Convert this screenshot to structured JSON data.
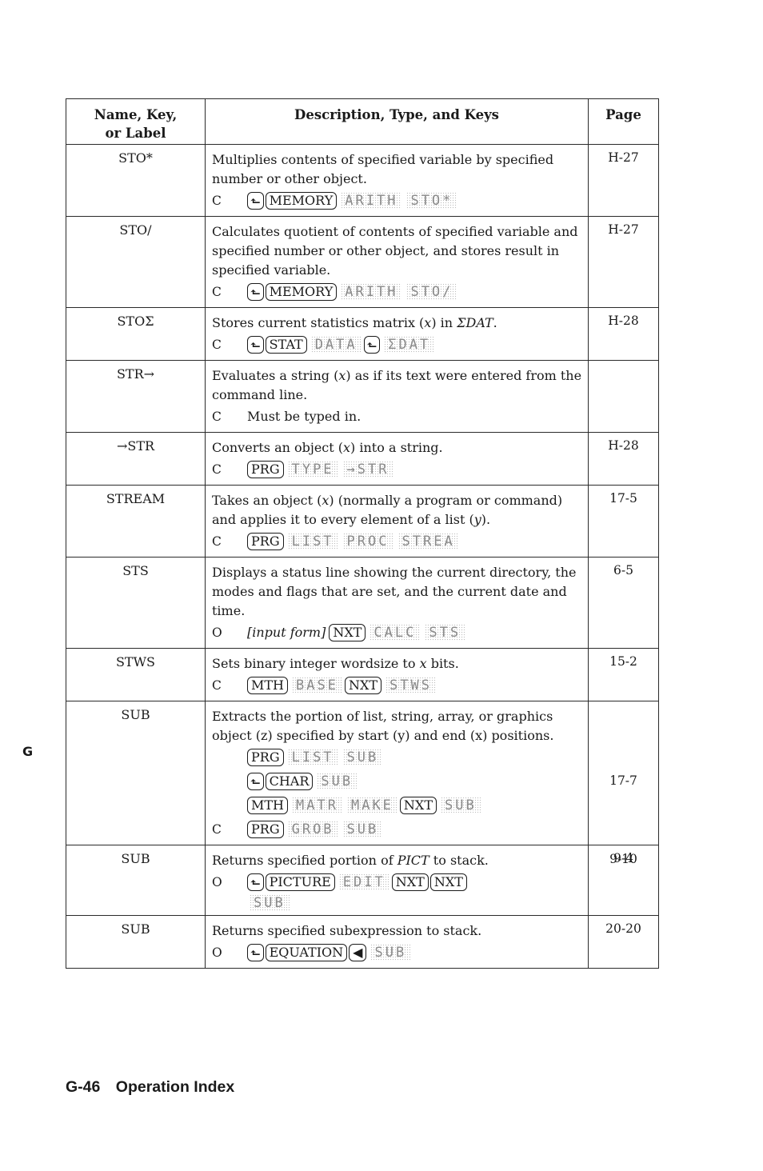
{
  "header": {
    "name_col": "Name, Key,\nor Label",
    "name_col_line1": "Name, Key,",
    "name_col_line2": "or Label",
    "desc_col": "Description, Type, and Keys",
    "page_col": "Page"
  },
  "rows": [
    {
      "name": "STO*",
      "description": "Multiplies contents of specified variable by specified number or other object.",
      "type": "C",
      "keys": [
        {
          "kind": "shift",
          "label": "⬑"
        },
        {
          "kind": "key",
          "label": "MEMORY"
        },
        {
          "kind": "soft",
          "label": "ARITH"
        },
        {
          "kind": "soft",
          "label": "STO*"
        }
      ],
      "page": "H-27"
    },
    {
      "name": "STO/",
      "description": "Calculates quotient of contents of specified variable and specified number or other object, and stores result in specified variable.",
      "type": "C",
      "keys": [
        {
          "kind": "shift",
          "label": "⬑"
        },
        {
          "kind": "key",
          "label": "MEMORY"
        },
        {
          "kind": "soft",
          "label": "ARITH"
        },
        {
          "kind": "soft",
          "label": "STO/"
        }
      ],
      "page": "H-27"
    },
    {
      "name": "STOΣ",
      "description_pre": "Stores current statistics matrix (",
      "description_var": "x",
      "description_mid": ") in ",
      "description_ital": "ΣDAT",
      "description_post": ".",
      "type": "C",
      "keys": [
        {
          "kind": "shift",
          "label": "⬑"
        },
        {
          "kind": "key",
          "label": "STAT"
        },
        {
          "kind": "soft",
          "label": "DATA"
        },
        {
          "kind": "shift",
          "label": "⬑"
        },
        {
          "kind": "soft",
          "label": "ΣDAT"
        }
      ],
      "page": "H-28"
    },
    {
      "name": "STR→",
      "description_pre": "Evaluates a string (",
      "description_var": "x",
      "description_post": ") as if its text were entered from the command line.",
      "type": "C",
      "typed": "Must be typed in.",
      "page": ""
    },
    {
      "name": "→STR",
      "description_pre": "Converts an object (",
      "description_var": "x",
      "description_post": ") into a string.",
      "type": "C",
      "keys": [
        {
          "kind": "key",
          "label": "PRG"
        },
        {
          "kind": "soft",
          "label": "TYPE"
        },
        {
          "kind": "soft",
          "label": "→STR"
        }
      ],
      "page": "H-28"
    },
    {
      "name": "STREAM",
      "description_pre": "Takes an object (",
      "description_var": "x",
      "description_mid": ") (normally a program or command) and applies it to every element of a list (",
      "description_var2": "y",
      "description_post": ").",
      "type": "C",
      "keys": [
        {
          "kind": "key",
          "label": "PRG"
        },
        {
          "kind": "soft",
          "label": "LIST"
        },
        {
          "kind": "soft",
          "label": "PROC"
        },
        {
          "kind": "soft",
          "label": "STREA"
        }
      ],
      "page": "17-5"
    },
    {
      "name": "STS",
      "description": "Displays a status line showing the current directory, the modes and flags that are set, and the current date and time.",
      "type": "O",
      "prefix_ital": "[input form]",
      "keys": [
        {
          "kind": "key",
          "label": "NXT"
        },
        {
          "kind": "soft",
          "label": "CALC"
        },
        {
          "kind": "soft",
          "label": "STS"
        }
      ],
      "page": "6-5"
    },
    {
      "name": "STWS",
      "description_pre": "Sets binary integer wordsize to ",
      "description_var": "x",
      "description_post": " bits.",
      "type": "C",
      "keys": [
        {
          "kind": "key",
          "label": "MTH"
        },
        {
          "kind": "soft",
          "label": "BASE"
        },
        {
          "kind": "key",
          "label": "NXT"
        },
        {
          "kind": "soft",
          "label": "STWS"
        }
      ],
      "page": "15-2"
    },
    {
      "name": "SUB",
      "description": "Extracts the portion of list, string, array, or graphics object (z) specified by start (y) and end (x) positions.",
      "type": "C",
      "keylines": [
        {
          "type": "",
          "keys": [
            {
              "kind": "key",
              "label": "PRG"
            },
            {
              "kind": "soft",
              "label": "LIST"
            },
            {
              "kind": "soft",
              "label": "SUB"
            }
          ],
          "page": "17-7"
        },
        {
          "type": "",
          "keys": [
            {
              "kind": "shift",
              "label": "⬑"
            },
            {
              "kind": "key",
              "label": "CHAR"
            },
            {
              "kind": "soft",
              "label": "SUB"
            }
          ],
          "page": ""
        },
        {
          "type": "",
          "keys": [
            {
              "kind": "key",
              "label": "MTH"
            },
            {
              "kind": "soft",
              "label": "MATR"
            },
            {
              "kind": "soft",
              "label": "MAKE"
            },
            {
              "kind": "key",
              "label": "NXT"
            },
            {
              "kind": "soft",
              "label": "SUB"
            }
          ],
          "page": ""
        },
        {
          "type": "C",
          "keys": [
            {
              "kind": "key",
              "label": "PRG"
            },
            {
              "kind": "soft",
              "label": "GROB"
            },
            {
              "kind": "soft",
              "label": "SUB"
            }
          ],
          "page": "9-10"
        }
      ],
      "page": ""
    },
    {
      "name": "SUB",
      "description_pre": "Returns specified portion of ",
      "description_ital": "PICT",
      "description_post": " to stack.",
      "type": "O",
      "keys": [
        {
          "kind": "shift",
          "label": "⬑"
        },
        {
          "kind": "key",
          "label": "PICTURE"
        },
        {
          "kind": "soft",
          "label": "EDIT"
        },
        {
          "kind": "key",
          "label": "NXT"
        },
        {
          "kind": "key",
          "label": "NXT"
        }
      ],
      "keys_cont": [
        {
          "kind": "soft",
          "label": "SUB"
        }
      ],
      "page": "9-4"
    },
    {
      "name": "SUB",
      "description": "Returns specified subexpression to stack.",
      "type": "O",
      "keys": [
        {
          "kind": "shift",
          "label": "⬑"
        },
        {
          "kind": "key",
          "label": "EQUATION"
        },
        {
          "kind": "key",
          "label": "◀"
        },
        {
          "kind": "soft",
          "label": "SUB"
        }
      ],
      "page": "20-20"
    }
  ],
  "side_tab": "G",
  "footer": {
    "page_number": "G-46",
    "section": "Operation Index"
  }
}
